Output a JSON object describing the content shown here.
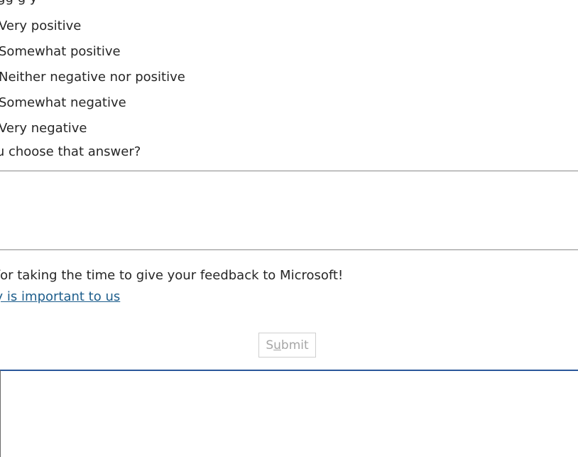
{
  "survey": {
    "question_fragment": "y                                                    g   p     g, g           ,                   gg                          g y",
    "options": [
      {
        "label": "Very positive"
      },
      {
        "label": "Somewhat positive"
      },
      {
        "label": "Neither negative nor positive"
      },
      {
        "label": "Somewhat negative"
      },
      {
        "label": "Very negative"
      }
    ],
    "why_label": "Why did you choose that answer?",
    "comment_value": "",
    "thanks_text": "Thank you for taking the time to give your feedback to Microsoft!",
    "privacy_link": "Your privacy is important to us",
    "submit_label_pre": "S",
    "submit_label_u": "u",
    "submit_label_post": "bmit"
  },
  "colors": {
    "link": "#1e5e8c",
    "accent": "#2b579a",
    "disabled_text": "#a6a6a6"
  }
}
